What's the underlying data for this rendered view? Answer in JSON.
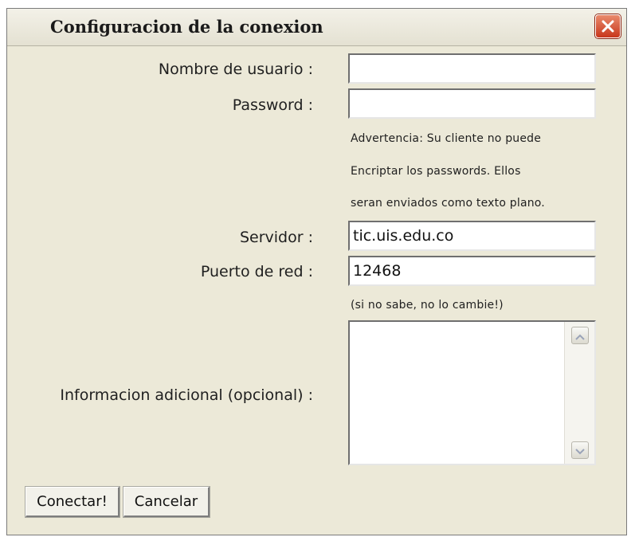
{
  "window": {
    "title": "Configuracion de la conexion",
    "close_icon": "close-icon"
  },
  "form": {
    "username": {
      "label": "Nombre de usuario :",
      "value": ""
    },
    "password": {
      "label": "Password :",
      "value": ""
    },
    "warning_lines": [
      "Advertencia: Su cliente no puede",
      "Encriptar los passwords.  Ellos",
      "seran enviados como texto plano."
    ],
    "server": {
      "label": "Servidor :",
      "value": "tic.uis.edu.co"
    },
    "port": {
      "label": "Puerto de red :",
      "value": "12468",
      "hint": "(si no sabe, no lo cambie!)"
    },
    "additional_info": {
      "label": "Informacion adicional  (opcional) :",
      "value": ""
    }
  },
  "buttons": {
    "connect": "Conectar!",
    "cancel": "Cancelar"
  },
  "colors": {
    "dialog_background": "#ece9d8",
    "close_button": "#c8361c"
  }
}
